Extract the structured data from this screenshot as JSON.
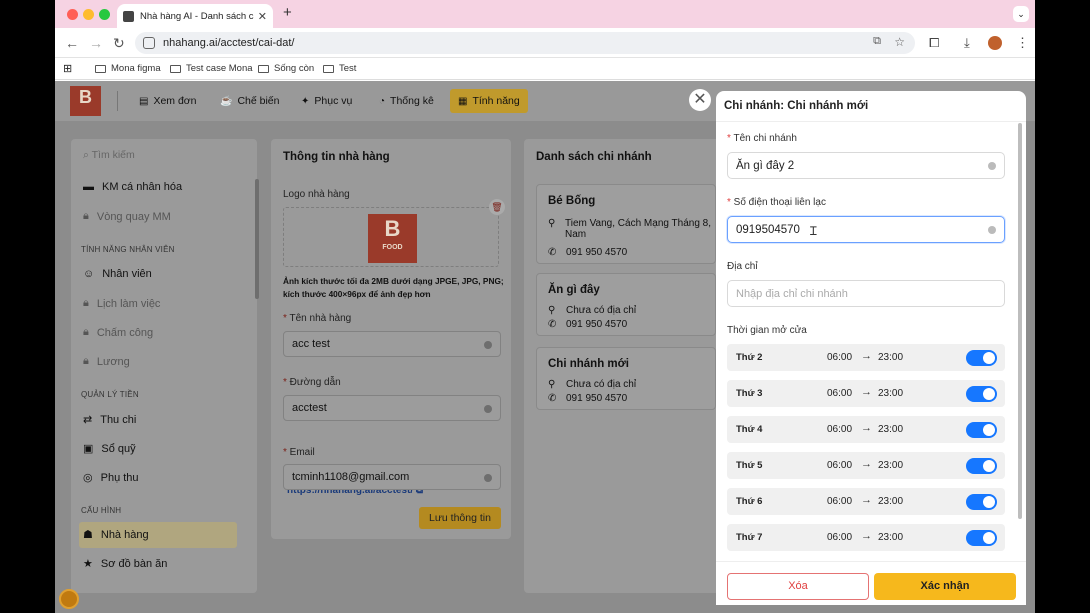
{
  "browser": {
    "tab_title": "Nhà hàng AI - Danh sách cài đ",
    "url": "nhahang.ai/acctest/cai-dat/",
    "bookmarks": [
      "Mona figma",
      "Test case Mona",
      "Sống còn",
      "Test"
    ]
  },
  "nav": {
    "logo": "B",
    "items": [
      "Xem đơn",
      "Chế biến",
      "Phục vụ",
      "Thống kê",
      "Tính năng"
    ],
    "active": "Tính năng"
  },
  "sidebar": {
    "search_placeholder": "Tìm kiếm",
    "items_top": [
      "KM cá nhân hóa",
      "Vòng quay MM"
    ],
    "section_staff": "TÍNH NĂNG NHÂN VIÊN",
    "staff_items": [
      "Nhân viên",
      "Lịch làm việc",
      "Chấm công",
      "Lương"
    ],
    "section_money": "QUẢN LÝ TIỀN",
    "money_items": [
      "Thu chi",
      "Sổ quỹ",
      "Phụ thu"
    ],
    "section_config": "CẤU HÌNH",
    "config_items": [
      "Nhà hàng",
      "Sơ đồ bàn ăn"
    ]
  },
  "info": {
    "title": "Thông tin nhà hàng",
    "logo_label": "Logo nhà hàng",
    "logo_text": "B",
    "logo_sub": "FOOD",
    "note": "Ảnh kích thước tối đa 2MB dưới dạng JPGE, JPG, PNG; kích thước 400×96px để ảnh đẹp hơn",
    "name_label": "Tên nhà hàng",
    "name_value": "acc test",
    "path_label": "Đường dẫn",
    "path_value": "acctest",
    "link": "https://nhahang.ai/acctest/",
    "email_label": "Email",
    "email_value": "tcminh1108@gmail.com",
    "save": "Lưu thông tin"
  },
  "branches": {
    "title": "Danh sách chi nhánh",
    "list": [
      {
        "name": "Bé Bống",
        "address": "Tiem Vang, Cách Mạng Tháng 8, Nam",
        "phone": "091 950 4570"
      },
      {
        "name": "Ăn gì đây",
        "address": "Chưa có địa chỉ",
        "phone": "091 950 4570"
      },
      {
        "name": "Chi nhánh mới",
        "address": "Chưa có địa chỉ",
        "phone": "091 950 4570"
      }
    ]
  },
  "drawer": {
    "title": "Chi nhánh: Chi nhánh mới",
    "name_label": "Tên chi nhánh",
    "name_value": "Ăn gì đây 2",
    "phone_label": "Số điện thoại liên lạc",
    "phone_value": "0919504570",
    "addr_label": "Địa chỉ",
    "addr_placeholder": "Nhập địa chỉ chi nhánh",
    "hours_label": "Thời gian mở cửa",
    "days": [
      {
        "day": "Thứ 2",
        "open": "06:00",
        "close": "23:00"
      },
      {
        "day": "Thứ 3",
        "open": "06:00",
        "close": "23:00"
      },
      {
        "day": "Thứ 4",
        "open": "06:00",
        "close": "23:00"
      },
      {
        "day": "Thứ 5",
        "open": "06:00",
        "close": "23:00"
      },
      {
        "day": "Thứ 6",
        "open": "06:00",
        "close": "23:00"
      },
      {
        "day": "Thứ 7",
        "open": "06:00",
        "close": "23:00"
      }
    ],
    "delete": "Xóa",
    "confirm": "Xác nhận"
  },
  "colors": {
    "accent": "#f6b81c",
    "toggle": "#1677ff",
    "danger": "#e04040"
  }
}
